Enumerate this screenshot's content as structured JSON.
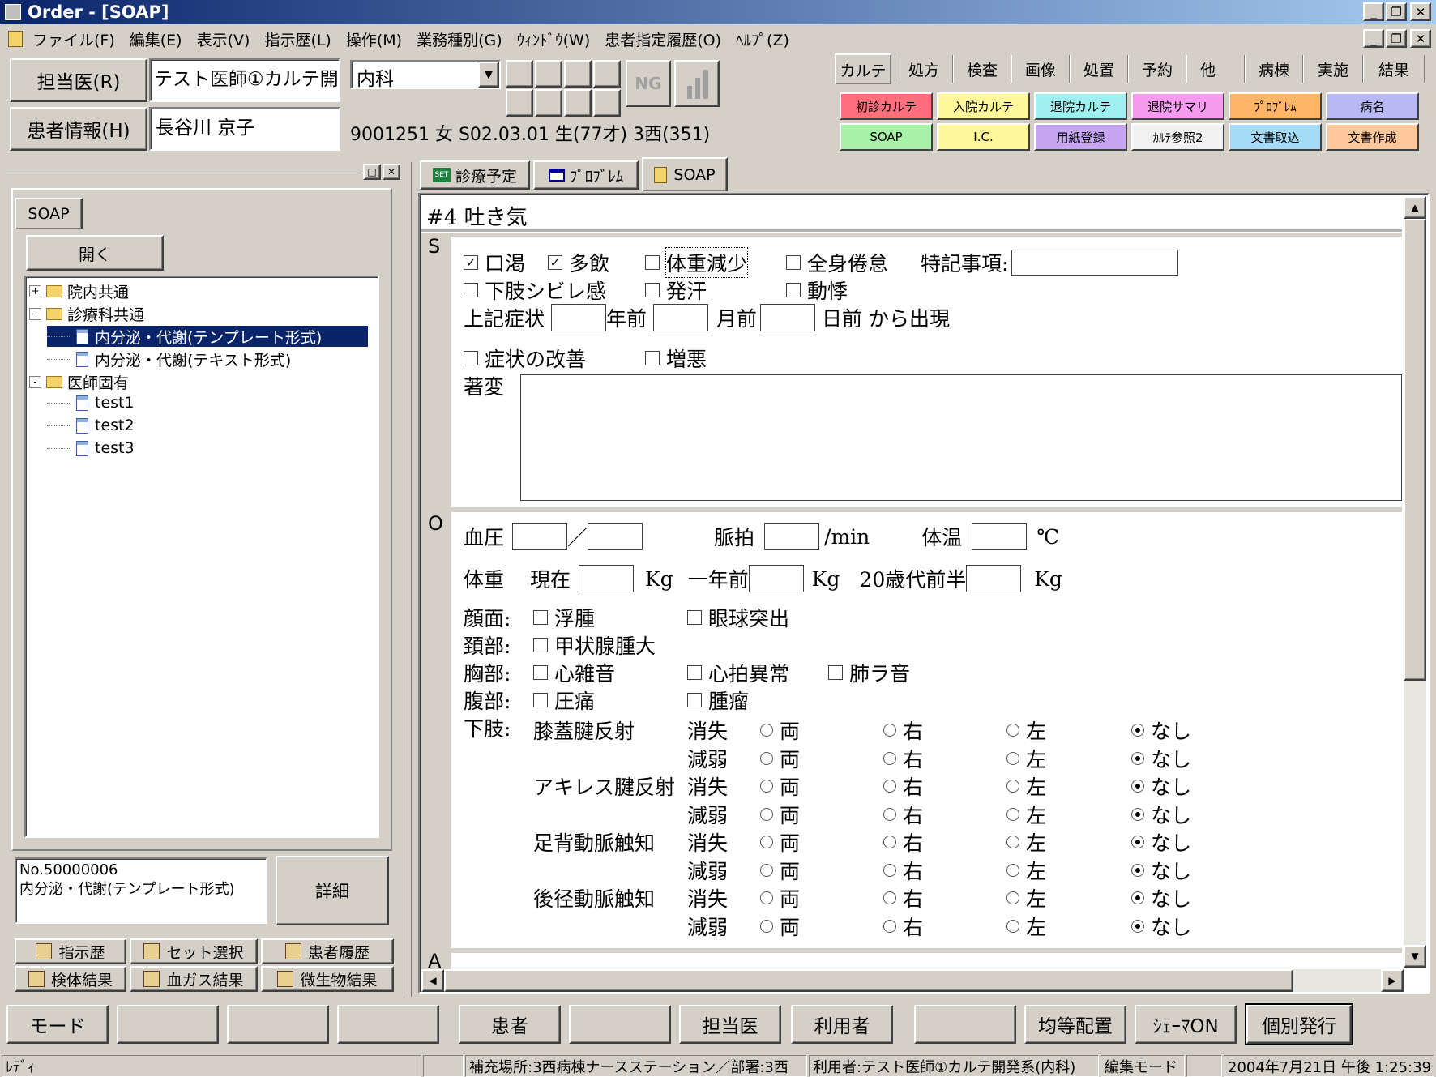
{
  "window": {
    "title": "Order - [SOAP]"
  },
  "menu": [
    "ファイル(F)",
    "編集(E)",
    "表示(V)",
    "指示歴(L)",
    "操作(M)",
    "業務種別(G)",
    "ｳｨﾝﾄﾞｳ(W)",
    "患者指定履歴(O)",
    "ﾍﾙﾌﾟ(Z)"
  ],
  "header": {
    "doctor_button": "担当医(R)",
    "doctor_name": "テスト医師①カルテ開",
    "department": "内科",
    "patient_button": "患者情報(H)",
    "patient_name": "長谷川 京子",
    "patient_info": "9001251 女 S02.03.01 生(77才) 3西(351)",
    "ng_icon": "NG"
  },
  "top_tabs": [
    "カルテ",
    "処方",
    "検査",
    "画像",
    "処置",
    "予約",
    "他",
    "病棟",
    "実施",
    "結果"
  ],
  "karte_buttons": [
    {
      "label": "初診カルテ",
      "color": "#ff6f7c"
    },
    {
      "label": "入院カルテ",
      "color": "#fff79c"
    },
    {
      "label": "退院カルテ",
      "color": "#9ff0f0"
    },
    {
      "label": "退院サマリ",
      "color": "#f79bf1"
    },
    {
      "label": "ﾌﾟﾛﾌﾞﾚﾑ",
      "color": "#ffb466"
    },
    {
      "label": "病名",
      "color": "#b8b8f5"
    },
    {
      "label": "SOAP",
      "color": "#a6f2a6"
    },
    {
      "label": "I.C.",
      "color": "#fff79c"
    },
    {
      "label": "用紙登録",
      "color": "#c6a6f2"
    },
    {
      "label": "ｶﾙﾃ参照2",
      "color": "#f1f1f1"
    },
    {
      "label": "文書取込",
      "color": "#a6dbf7"
    },
    {
      "label": "文書作成",
      "color": "#ffc89a"
    }
  ],
  "left": {
    "tab": "SOAP",
    "open_button": "開く",
    "tree": [
      {
        "label": "院内共通",
        "type": "folder",
        "expander": "+"
      },
      {
        "label": "診療科共通",
        "type": "folder",
        "expander": "-"
      },
      {
        "label": "内分泌・代謝(テンプレート形式)",
        "type": "doc",
        "selected": true
      },
      {
        "label": "内分泌・代謝(テキスト形式)",
        "type": "doc"
      },
      {
        "label": "医師固有",
        "type": "folder",
        "expander": "-"
      },
      {
        "label": "test1",
        "type": "doc"
      },
      {
        "label": "test2",
        "type": "doc"
      },
      {
        "label": "test3",
        "type": "doc"
      }
    ],
    "info_no": "No.50000006",
    "info_name": "内分泌・代謝(テンプレート形式)",
    "detail_button": "詳細",
    "bottom_buttons": [
      "指示歴",
      "セット選択",
      "患者履歴",
      "検体結果",
      "血ガス結果",
      "微生物結果"
    ]
  },
  "doc_tabs": [
    "診療予定",
    "ﾌﾟﾛﾌﾞﾚﾑ",
    "SOAP"
  ],
  "soap": {
    "problem": "#4 吐き気",
    "s_label": "S",
    "o_label": "O",
    "a_label": "A",
    "s_checks1": [
      {
        "label": "口渇",
        "checked": true
      },
      {
        "label": "多飲",
        "checked": true
      },
      {
        "label": "体重減少",
        "checked": false
      },
      {
        "label": "全身倦怠",
        "checked": false
      }
    ],
    "special_label": "特記事項:",
    "s_checks2": [
      {
        "label": "下肢シビレ感",
        "checked": false
      },
      {
        "label": "発汗",
        "checked": false
      },
      {
        "label": "動悸",
        "checked": false
      }
    ],
    "onset": {
      "prefix": "上記症状",
      "years": "年前",
      "months": "月前",
      "days": "日前 から出現"
    },
    "s_checks3": [
      {
        "label": "症状の改善",
        "checked": false
      },
      {
        "label": "増悪",
        "checked": false
      }
    ],
    "remarks_label": "著変",
    "bp_label": "血圧",
    "bp_sep": "／",
    "pulse_label": "脈拍",
    "pulse_unit": "/min",
    "temp_label": "体温",
    "temp_unit": "℃",
    "weight_label": "体重",
    "weight_now": "現在",
    "weight_year": "一年前",
    "weight_20s": "20歳代前半",
    "kg": "Kg",
    "face_label": "顔面:",
    "face": [
      "浮腫",
      "眼球突出"
    ],
    "neck_label": "頚部:",
    "neck": [
      "甲状腺腫大"
    ],
    "chest_label": "胸部:",
    "chest": [
      "心雑音",
      "心拍異常",
      "肺ラ音"
    ],
    "abd_label": "腹部:",
    "abd": [
      "圧痛",
      "腫瘤"
    ],
    "limb_label": "下肢:",
    "reflexes": [
      "膝蓋腱反射",
      "アキレス腱反射",
      "足背動脈触知",
      "後径動脈触知"
    ],
    "levels": [
      "消失",
      "減弱"
    ],
    "opts": [
      "両",
      "右",
      "左",
      "なし"
    ],
    "selected": "なし"
  },
  "func_buttons": [
    "モード",
    "",
    "",
    "",
    "患者",
    "",
    "担当医",
    "利用者",
    "",
    "均等配置",
    "ｼｪｰﾏON",
    "個別発行"
  ],
  "status": {
    "left": "ﾚﾃﾞｨ",
    "place": "補充場所:3西病棟ナースステーション／部署:3西",
    "user": "利用者:テスト医師①カルテ開発系(内科)",
    "mode": "編集モード",
    "datetime": "2004年7月21日 午後 1:25:39"
  }
}
